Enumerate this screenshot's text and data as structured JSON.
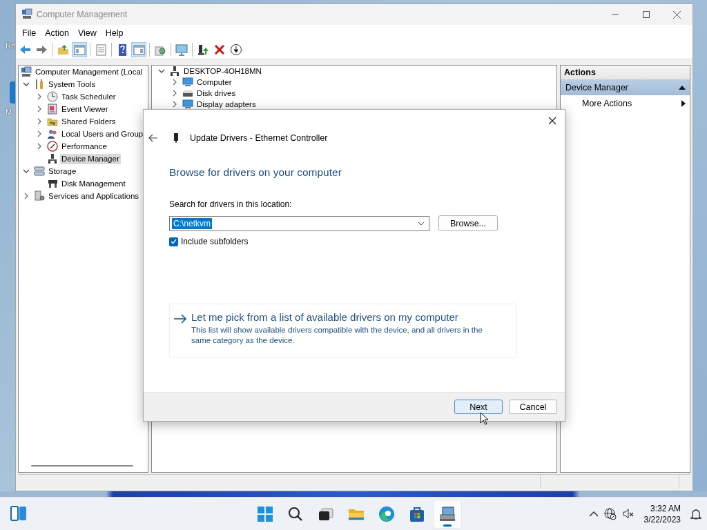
{
  "desktop": {
    "icon_labels": [
      "Re",
      "M"
    ]
  },
  "window": {
    "title": "Computer Management",
    "active": false
  },
  "menu": [
    "File",
    "Action",
    "View",
    "Help"
  ],
  "toolbar": [
    {
      "kind": "back",
      "pressed": false
    },
    {
      "kind": "forward",
      "pressed": false
    },
    {
      "kind": "up",
      "pressed": false
    },
    {
      "kind": "tree",
      "pressed": true
    },
    {
      "kind": "properties",
      "pressed": false
    },
    {
      "kind": "help",
      "pressed": false
    },
    {
      "kind": "actionpane",
      "pressed": true
    },
    {
      "kind": "scan",
      "pressed": false
    },
    {
      "kind": "monitor",
      "pressed": false
    },
    {
      "kind": "update",
      "pressed": false
    },
    {
      "kind": "remove",
      "pressed": false
    },
    {
      "kind": "download",
      "pressed": false
    }
  ],
  "console_tree": [
    {
      "label": "Computer Management (Local",
      "kind": "computer",
      "selected": false,
      "children": [
        {
          "label": "System Tools",
          "kind": "tools",
          "expanded": true,
          "selected": false,
          "children": [
            {
              "label": "Task Scheduler",
              "kind": "clock",
              "expanded": false,
              "selected": false
            },
            {
              "label": "Event Viewer",
              "kind": "events",
              "expanded": false,
              "selected": false
            },
            {
              "label": "Shared Folders",
              "kind": "folder",
              "expanded": false,
              "selected": false
            },
            {
              "label": "Local Users and Group",
              "kind": "users",
              "expanded": false,
              "selected": false
            },
            {
              "label": "Performance",
              "kind": "performance",
              "expanded": false,
              "selected": false
            },
            {
              "label": "Device Manager",
              "kind": "device",
              "selected": true
            }
          ]
        },
        {
          "label": "Storage",
          "kind": "storage",
          "expanded": true,
          "selected": false,
          "children": [
            {
              "label": "Disk Management",
              "kind": "disk",
              "selected": false
            }
          ]
        },
        {
          "label": "Services and Applications",
          "kind": "services",
          "expanded": false,
          "selected": false
        }
      ]
    }
  ],
  "device_tree": [
    {
      "label": "DESKTOP-4OH18MN",
      "kind": "device",
      "expanded": true,
      "selected": false,
      "children": [
        {
          "label": "Computer",
          "kind": "monitor",
          "expanded": false,
          "selected": false
        },
        {
          "label": "Disk drives",
          "kind": "drive",
          "expanded": false,
          "selected": false
        },
        {
          "label": "Display adapters",
          "kind": "monitor",
          "expanded": false,
          "selected": false
        }
      ]
    }
  ],
  "actions": {
    "title": "Actions",
    "section": {
      "label": "Device Manager",
      "expanded": true
    },
    "items": [
      "More Actions"
    ]
  },
  "dialog": {
    "title": "Update Drivers - Ethernet Controller",
    "heading": "Browse for drivers on your computer",
    "location_label": "Search for drivers in this location:",
    "location_value": "C:\\netkvm",
    "browse": "Browse...",
    "include_subfolders": {
      "label": "Include subfolders",
      "checked": true
    },
    "pick_link": "Let me pick from a list of available drivers on my computer",
    "pick_description": "This list will show available drivers compatible with the device, and all drivers in the same category as the device.",
    "buttons": [
      {
        "label": "Next",
        "default": true
      },
      {
        "label": "Cancel",
        "default": false
      }
    ]
  },
  "taskbar": {
    "apps": [
      {
        "kind": "start",
        "active": false
      },
      {
        "kind": "search",
        "active": false
      },
      {
        "kind": "taskview",
        "active": false
      },
      {
        "kind": "explorer",
        "active": false
      },
      {
        "kind": "edge",
        "active": false
      },
      {
        "kind": "store",
        "active": false
      },
      {
        "kind": "compmgmt",
        "active": true
      }
    ],
    "time": "3:32 AM",
    "date": "3/22/2023"
  }
}
